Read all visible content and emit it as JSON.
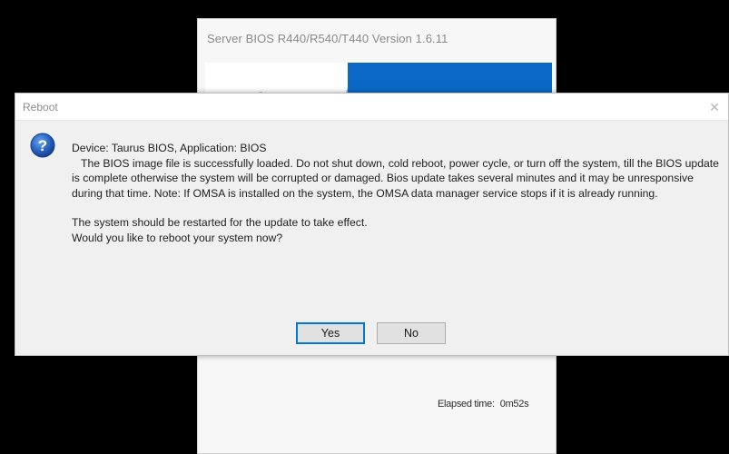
{
  "background_window": {
    "title": "Server BIOS R440/R540/T440 Version 1.6.11",
    "elapsed_label": "Elapsed time:",
    "elapsed_value": "0m52s"
  },
  "dialog": {
    "title": "Reboot",
    "close_icon": "✕",
    "icon": "question-icon",
    "line1": "Device: Taurus BIOS, Application: BIOS",
    "paragraph": "The BIOS image file is successfully loaded. Do not shut down, cold reboot, power cycle, or turn off the system, till the BIOS update is complete otherwise the system will be corrupted or damaged. Bios update takes several minutes and it may be unresponsive during that time. Note: If OMSA is installed on the system, the OMSA data manager service stops if it is already running.",
    "line3": "The system should be restarted for the update to take effect.",
    "line4": "Would you like to reboot your system now?",
    "yes_label": "Yes",
    "no_label": "No"
  },
  "colors": {
    "accent": "#0078d7",
    "banner_blue": "#0b68c4",
    "question_icon_blue": "#2a64c5"
  }
}
